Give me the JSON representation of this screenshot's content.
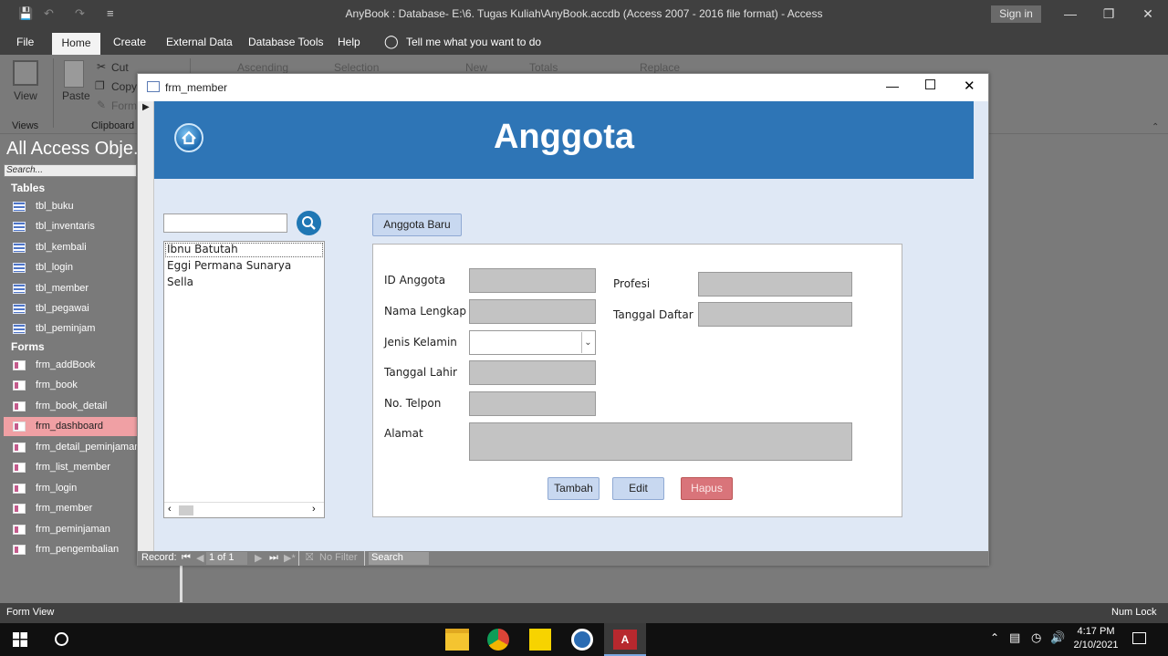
{
  "app": {
    "title": "AnyBook : Database- E:\\6. Tugas Kuliah\\AnyBook.accdb (Access 2007 - 2016 file format)  -  Access",
    "sign_in": "Sign in"
  },
  "menu": {
    "items": [
      "File",
      "Home",
      "Create",
      "External Data",
      "Database Tools",
      "Help"
    ],
    "tell_me": "Tell me what you want to do"
  },
  "ribbon": {
    "view": "View",
    "paste": "Paste",
    "cut": "Cut",
    "copy": "Copy",
    "format": "Forma",
    "ascending": "Ascending",
    "selection": "Selection",
    "new": "New",
    "totals": "Totals",
    "replace": "Replace",
    "group_views": "Views",
    "group_clipboard": "Clipboard"
  },
  "nav": {
    "title": "All Access Obje..",
    "search_placeholder": "Search...",
    "tables_header": "Tables",
    "tables": [
      "tbl_buku",
      "tbl_inventaris",
      "tbl_kembali",
      "tbl_login",
      "tbl_member",
      "tbl_pegawai",
      "tbl_peminjam"
    ],
    "forms_header": "Forms",
    "forms": [
      "frm_addBook",
      "frm_book",
      "frm_book_detail",
      "frm_dashboard",
      "frm_detail_peminjaman",
      "frm_list_member",
      "frm_login",
      "frm_member",
      "frm_peminjaman",
      "frm_pengembalian"
    ],
    "selected": "frm_dashboard"
  },
  "form": {
    "window_title": "frm_member",
    "header_title": "Anggota",
    "new_button": "Anggota Baru",
    "list_items": [
      "Ibnu Batutah",
      "Eggi Permana Sunarya",
      "Sella"
    ],
    "labels": {
      "id": "ID Anggota",
      "name": "Nama Lengkap",
      "gender": "Jenis Kelamin",
      "dob": "Tanggal Lahir",
      "phone": "No. Telpon",
      "address": "Alamat",
      "job": "Profesi",
      "reg_date": "Tanggal Daftar"
    },
    "actions": {
      "add": "Tambah",
      "edit": "Edit",
      "delete": "Hapus"
    },
    "record_nav": {
      "label": "Record:",
      "position": "1 of 1",
      "filter": "No Filter",
      "search": "Search"
    }
  },
  "status": {
    "left": "Form View",
    "right": "Num Lock"
  },
  "taskbar": {
    "time": "4:17 PM",
    "date": "2/10/2021"
  },
  "colors": {
    "header_blue": "#2e75b6",
    "selected_nav": "#f0a0a4",
    "delete_btn": "#d9747a"
  }
}
